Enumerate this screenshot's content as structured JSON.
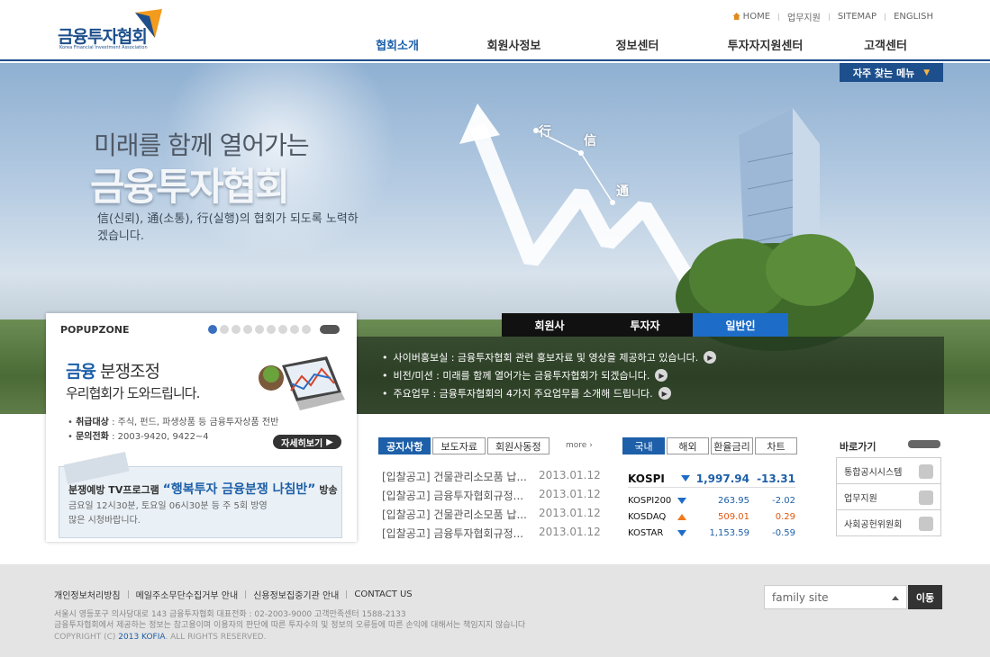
{
  "header": {
    "logo_text": "금융투자협회",
    "logo_sub": "Korea Financial Investment Association",
    "util": [
      "HOME",
      "업무지원",
      "SITEMAP",
      "ENGLISH"
    ],
    "nav": [
      "협회소개",
      "회원사정보",
      "정보센터",
      "투자자지원센터",
      "고객센터"
    ]
  },
  "hero": {
    "quick_menu": "자주 찾는 메뉴",
    "title1": "미래를 함께 열어가는",
    "title2": "금융투자협회",
    "desc": "信(신뢰), 通(소통), 行(실행)의 협회가 되도록 노력하겠습니다.",
    "chars": [
      "行",
      "信",
      "通"
    ],
    "tabs": [
      "회원사",
      "투자자",
      "일반인"
    ],
    "news": [
      "사이버홍보실 : 금융투자협회 관련 홍보자료 및 영상을 제공하고 있습니다.",
      "비전/미션 : 미래를 함께 열어가는 금융투자협회가 되겠습니다.",
      "주요업무 : 금융투자협회의 4가지 주요업무를 소개해 드립니다."
    ]
  },
  "popup": {
    "title": "POPUPZONE",
    "h1_strong": "금융",
    "h1_rest": " 분쟁조정",
    "h2": "우리협회가 도와드립니다.",
    "item1_label": "취급대상",
    "item1_text": " : 주식, 펀드, 파생상품 등 금융투자상품 전반",
    "item2_label": "문의전화",
    "item2_text": " : 2003-9420, 9422~4",
    "more": "자세히보기",
    "tv_prefix": "분쟁예방 TV프로그램",
    "tv_big": "“행복투자 금융분쟁 나침반”",
    "tv_suffix": " 방송",
    "tv_p1": "금요일 12시30분, 토요일 06시30분 등 주 5회 방영",
    "tv_p2": "많은 시청바랍니다."
  },
  "notice": {
    "tabs": [
      "공지사항",
      "보도자료",
      "회원사동정"
    ],
    "more": "more",
    "rows": [
      {
        "title": "[입찰공고] 건물관리소모품 납...",
        "date": "2013.01.12"
      },
      {
        "title": "[입찰공고] 금융투자협회규정...",
        "date": "2013.01.12"
      },
      {
        "title": "[입찰공고] 건물관리소모품 납...",
        "date": "2013.01.12"
      },
      {
        "title": "[입찰공고] 금융투자협회규정...",
        "date": "2013.01.12"
      }
    ]
  },
  "market": {
    "tabs": [
      "국내",
      "해외",
      "환율금리",
      "차트"
    ],
    "kospi": {
      "name": "KOSPI",
      "value": "1,997.94",
      "change": "-13.31"
    },
    "rows": [
      {
        "name": "KOSPI200",
        "value": "263.95",
        "change": "-2.02",
        "dir": "down"
      },
      {
        "name": "KOSDAQ",
        "value": "509.01",
        "change": "0.29",
        "dir": "up"
      },
      {
        "name": "KOSTAR",
        "value": "1,153.59",
        "change": "-0.59",
        "dir": "down"
      }
    ]
  },
  "quick": {
    "title": "바로가기",
    "items": [
      "통합공시시스템",
      "업무지원",
      "사회공헌위원회"
    ]
  },
  "footer": {
    "links": [
      "개인정보처리방침",
      "메일주소무단수집거부 안내",
      "신용정보집중기관 안내",
      "CONTACT US"
    ],
    "addr1": "서울시 영등포구 의사당대로 143 금융투자협회   대표전화 : 02-2003-9000    고객만족센터 1588-2133",
    "addr2": "금융투자협회에서 제공하는 정보는 참고용이며 이용자의 판단에 따른 투자수의 및 정보의 오류등에 따른 손익에 대해서는 책임지지 않습니다",
    "copy_pre": "COPYRIGHT (C) ",
    "copy_brand": "2013 KOFIA",
    "copy_post": ". ALL RIGHTS RESERVED.",
    "family_site": "family site",
    "go": "이동"
  },
  "colors": {
    "brand": "#1d4f8c",
    "accent": "#1d6dc8",
    "up": "#e0560e",
    "down": "#1d5fa8"
  }
}
